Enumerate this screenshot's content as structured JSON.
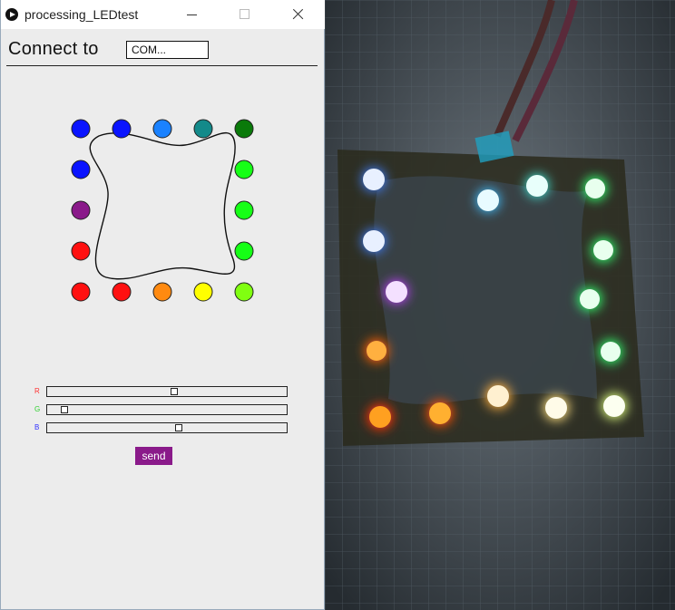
{
  "window": {
    "title": "processing_LEDtest",
    "icon": "processing-play-icon"
  },
  "connect": {
    "label": "Connect to",
    "port_value": "COM..."
  },
  "leds": [
    {
      "color": "#0a14ff"
    },
    {
      "color": "#0a14ff"
    },
    {
      "color": "#1a82ff"
    },
    {
      "color": "#138a8a"
    },
    {
      "color": "#0a7a0a"
    },
    {
      "color": "#0a14ff"
    },
    {
      "color": "#16ff16"
    },
    {
      "color": "#8a1a8a"
    },
    {
      "color": "#16ff16"
    },
    {
      "color": "#ff1010"
    },
    {
      "color": "#16ff16"
    },
    {
      "color": "#ff1010"
    },
    {
      "color": "#ff1010"
    },
    {
      "color": "#ff8a10"
    },
    {
      "color": "#ffff00"
    },
    {
      "color": "#80ff10"
    }
  ],
  "sliders": [
    {
      "label": "R",
      "color": "#ff3030",
      "value": 0.53
    },
    {
      "label": "G",
      "color": "#30d030",
      "value": 0.06
    },
    {
      "label": "B",
      "color": "#3030ff",
      "value": 0.55
    }
  ],
  "send": {
    "label": "send",
    "color": "#8a1a8a"
  },
  "photo": {
    "description_icon": "led-ring-photo"
  }
}
